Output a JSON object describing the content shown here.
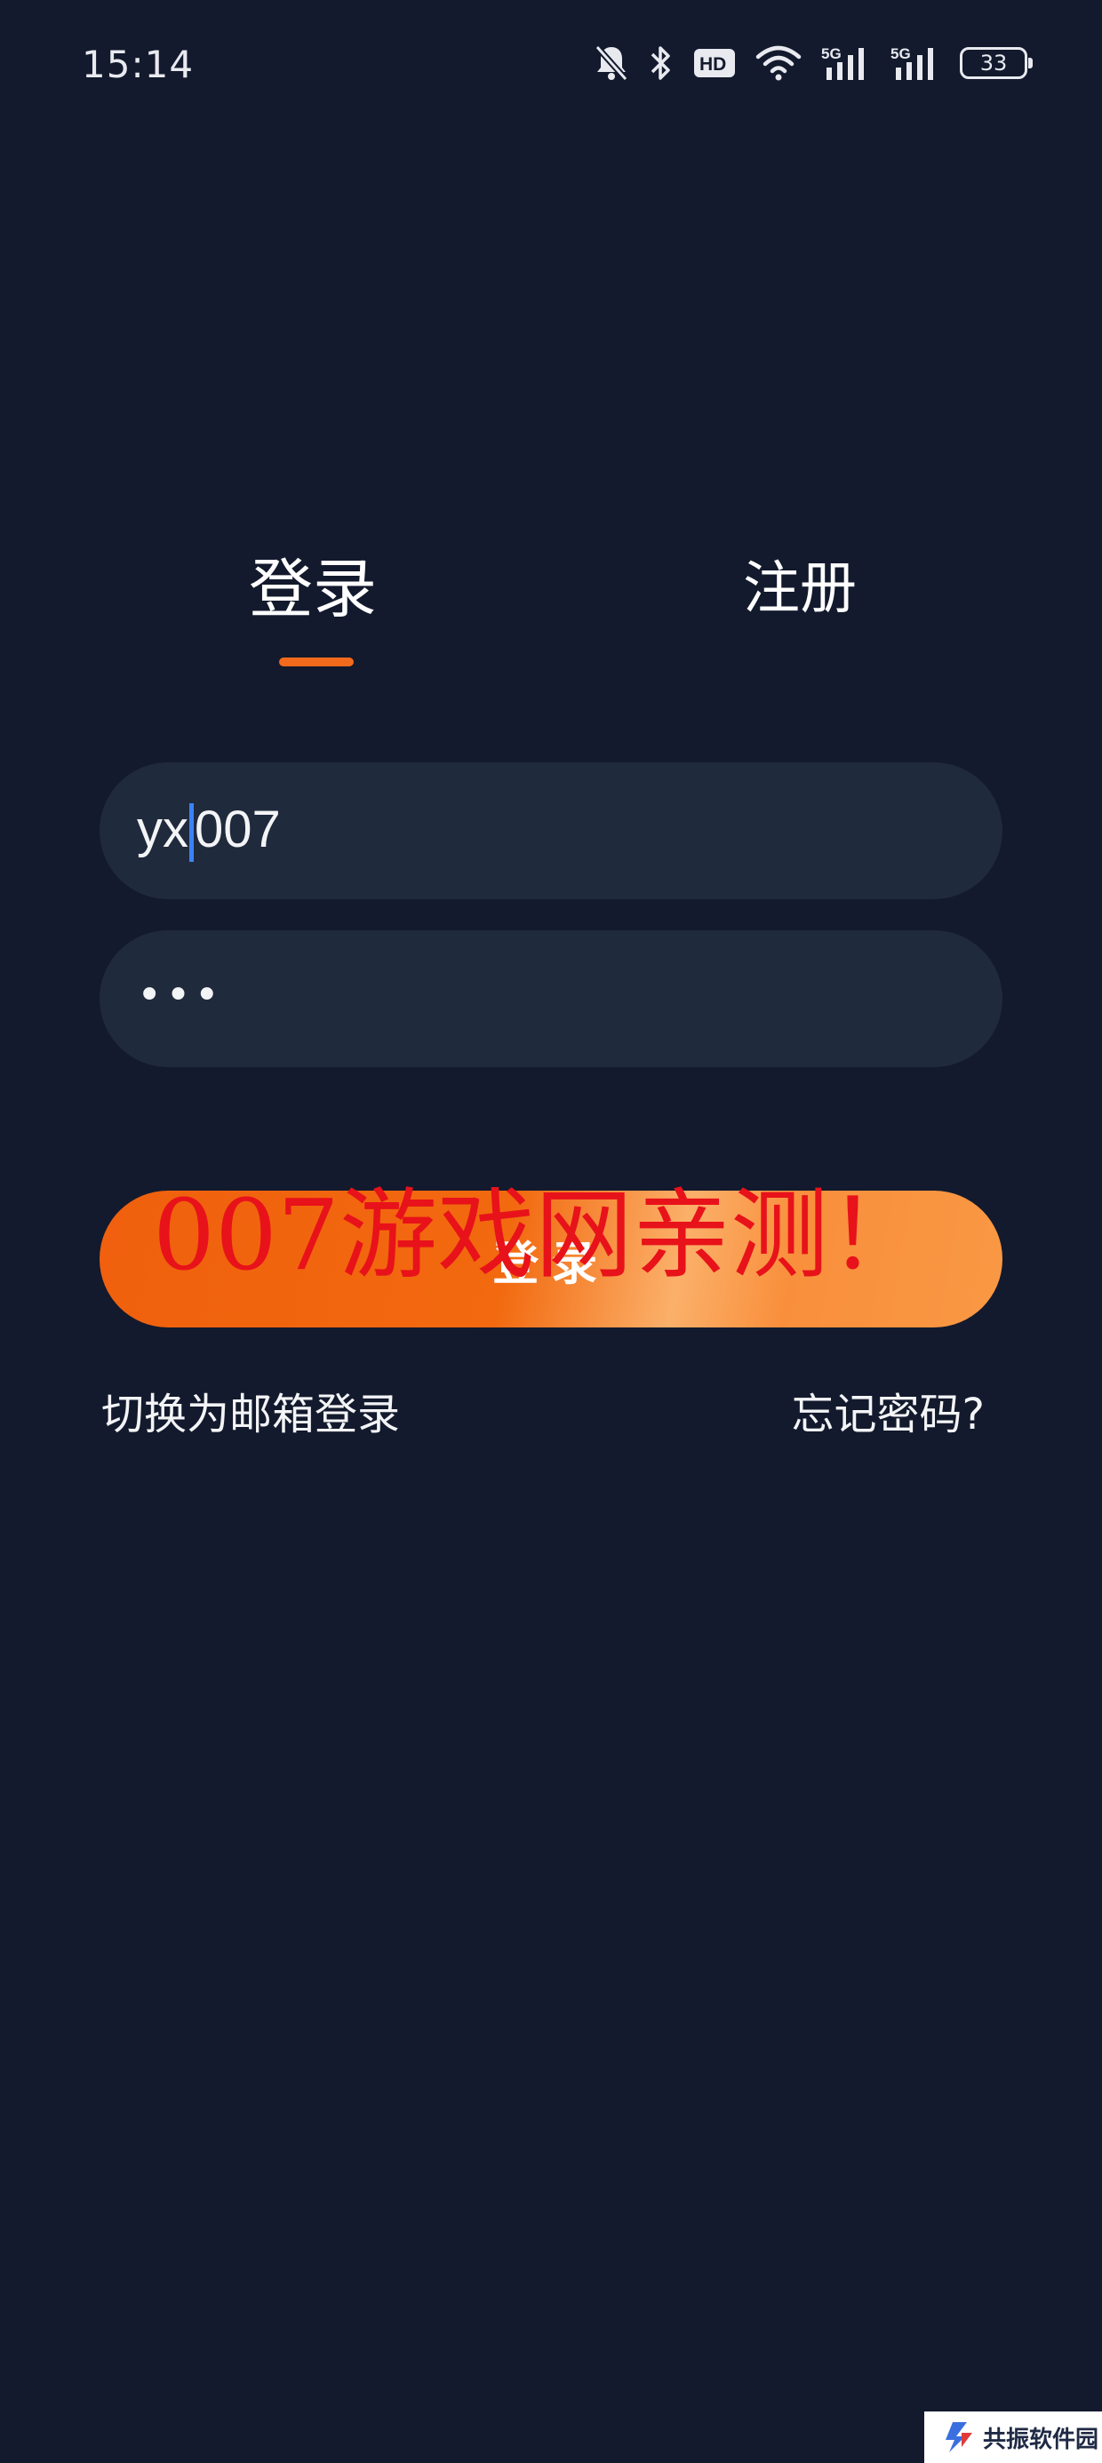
{
  "status_bar": {
    "time": "15:14",
    "icons": [
      "bell-off-icon",
      "bluetooth-icon",
      "hd-icon",
      "wifi-icon",
      "signal-5g-icon",
      "signal-5g-icon"
    ],
    "hd_label": "HD",
    "network_label_1": "5G",
    "network_label_2": "5G",
    "battery": "33"
  },
  "tabs": {
    "login_label": "登录",
    "register_label": "注册",
    "active": "login"
  },
  "form": {
    "username_value_before_caret": "yx",
    "username_value_after_caret": "007",
    "password_masked": "•••"
  },
  "actions": {
    "login_button_label": "登录",
    "switch_to_email_label": "切换为邮箱登录",
    "forgot_password_label": "忘记密码?"
  },
  "watermark": {
    "text": "007游戏网亲测！"
  },
  "site_logo": {
    "name": "共振软件园"
  },
  "colors": {
    "background": "#131a2d",
    "field": "#202a3d",
    "accent": "#f26a1b",
    "caret": "#3b82f6",
    "watermark": "#e8121a"
  }
}
